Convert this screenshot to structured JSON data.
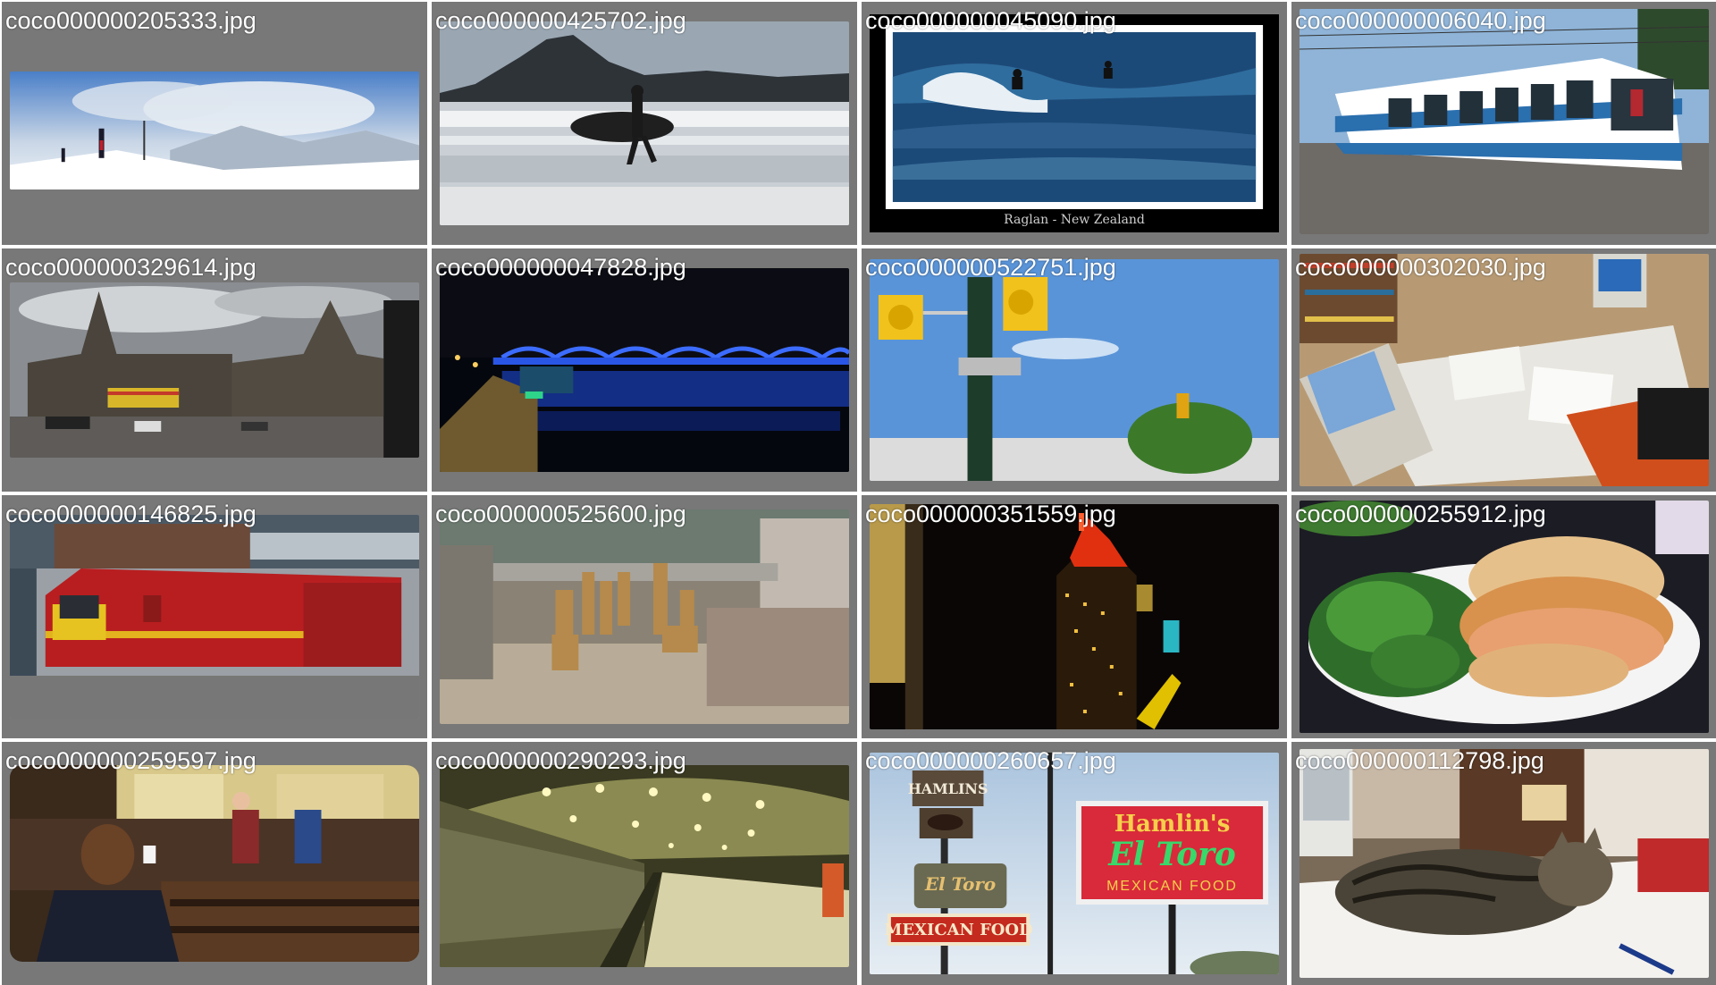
{
  "tiles": [
    {
      "filename": "coco000000205333.jpg",
      "icon": "ski-slope-image"
    },
    {
      "filename": "coco000000425702.jpg",
      "icon": "surfer-beach-image"
    },
    {
      "filename": "coco000000045090.jpg",
      "icon": "surfing-wave-image",
      "caption": "Raglan - New Zealand"
    },
    {
      "filename": "coco000000006040.jpg",
      "icon": "tram-image"
    },
    {
      "filename": "coco000000329614.jpg",
      "icon": "cathedral-image"
    },
    {
      "filename": "coco000000047828.jpg",
      "icon": "night-bridge-image"
    },
    {
      "filename": "coco000000522751.jpg",
      "icon": "traffic-light-image"
    },
    {
      "filename": "coco000000302030.jpg",
      "icon": "office-desk-image"
    },
    {
      "filename": "coco000000146825.jpg",
      "icon": "red-train-image"
    },
    {
      "filename": "coco000000525600.jpg",
      "icon": "giraffes-image"
    },
    {
      "filename": "coco000000351559.jpg",
      "icon": "empire-state-image"
    },
    {
      "filename": "coco000000255912.jpg",
      "icon": "sandwich-salad-image"
    },
    {
      "filename": "coco000000259597.jpg",
      "icon": "theater-crowd-image"
    },
    {
      "filename": "coco000000290293.jpg",
      "icon": "subway-station-image"
    },
    {
      "filename": "coco000000260657.jpg",
      "icon": "restaurant-signs-image",
      "sign_name": "HAMLINS",
      "sign_toro": "El Toro",
      "sign_food": "MEXICAN FOOD",
      "sign_big_name": "Hamlin's",
      "sign_big_toro": "El Toro",
      "sign_big_food": "MEXICAN FOOD"
    },
    {
      "filename": "coco000000112798.jpg",
      "icon": "sleeping-cat-image"
    }
  ],
  "colors": {
    "tile_background": "#787878",
    "label_text": "#ffffff"
  }
}
